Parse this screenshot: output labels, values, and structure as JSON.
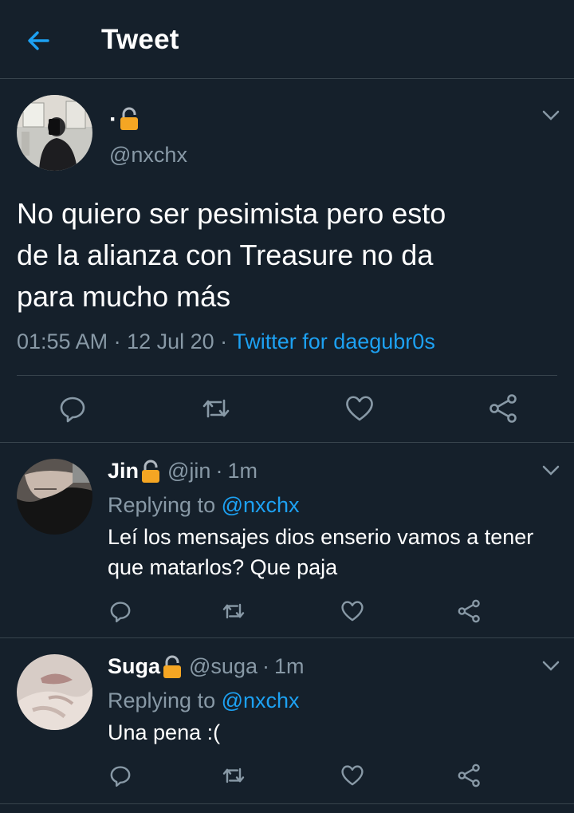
{
  "header": {
    "title": "Tweet"
  },
  "main_tweet": {
    "name": "·",
    "handle": "@nxchx",
    "text": "No quiero ser pesimista pero esto\nde la alianza con Treasure no da\npara mucho más",
    "time": "01:55 AM",
    "sep1": " · ",
    "date": "12 Jul 20",
    "sep2": " · ",
    "source": "Twitter for daegubr0s"
  },
  "replies": [
    {
      "name": "Jin",
      "handle": "@jin",
      "sep": "·",
      "time": "1m",
      "replying_prefix": "Replying to ",
      "replying_to": "@nxchx",
      "text": "Leí los mensajes dios enserio vamos a tener que matarlos? Que paja"
    },
    {
      "name": "Suga",
      "handle": "@suga",
      "sep": "·",
      "time": "1m",
      "replying_prefix": "Replying to ",
      "replying_to": "@nxchx",
      "text": "Una pena :("
    }
  ],
  "icons": {
    "back": "arrow-left-icon",
    "lock": "lock-icon",
    "caret": "chevron-down-icon",
    "reply": "reply-icon",
    "retweet": "retweet-icon",
    "like": "heart-icon",
    "share": "share-icon"
  },
  "colors": {
    "background": "#15202b",
    "accent": "#1da1f2",
    "secondary_text": "#8899a6",
    "divider": "#38444d",
    "lock": "#f5a623"
  }
}
